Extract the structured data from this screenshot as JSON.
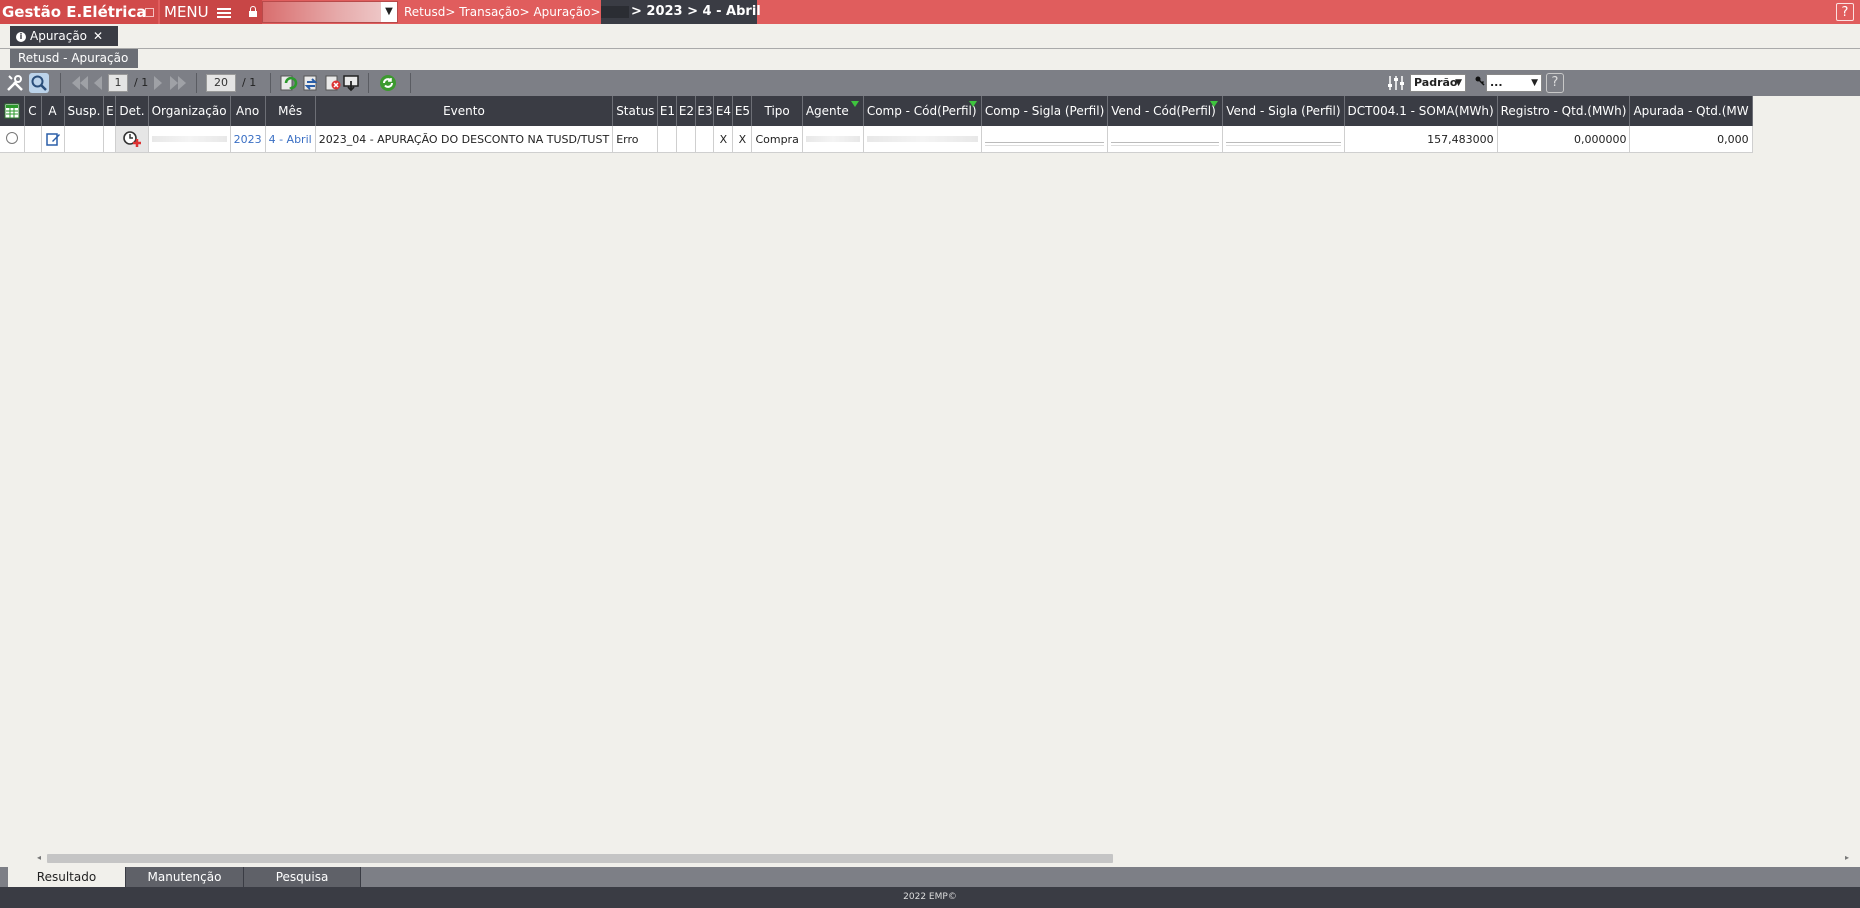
{
  "header": {
    "app_title": "Gestão E.Elétrica",
    "menu_label": "MENU",
    "breadcrumb": "Retusd> Transação> Apuração>",
    "breadcrumb_period": "> 2023 > 4 - Abril",
    "help_label": "?"
  },
  "tabs": {
    "doc_tab_label": "Apuração",
    "doc_tab_close": "✕",
    "sub_tab_label": "Retusd - Apuração"
  },
  "toolbar": {
    "page_current": "1",
    "page_total": "/ 1",
    "page_size": "20",
    "page_size_total": "/ 1",
    "layout_select": "Padrão",
    "filter_select": "..."
  },
  "table": {
    "columns": [
      "C",
      "A",
      "Susp.",
      "E",
      "Det.",
      "Organização",
      "Ano",
      "Mês",
      "Evento",
      "Status",
      "E1",
      "E2",
      "E3",
      "E4",
      "E5",
      "Tipo",
      "Agente",
      "Comp - Cód(Perfil)",
      "Comp - Sigla (Perfil)",
      "Vend - Cód(Perfil)",
      "Vend - Sigla (Perfil)",
      "DCT004.1 - SOMA(MWh)",
      "Registro - Qtd.(MWh)",
      "Apurada - Qtd.(MW"
    ],
    "rows": [
      {
        "ano": "2023",
        "mes": "4 - Abril",
        "evento": "2023_04 - APURAÇÃO DO DESCONTO NA TUSD/TUST",
        "status": "Erro",
        "e1": "",
        "e2": "",
        "e3": "",
        "e4": "X",
        "e5": "X",
        "tipo": "Compra",
        "soma": "157,483000",
        "registro": "0,000000",
        "apurada": "0,000"
      }
    ]
  },
  "bottom_tabs": [
    "Resultado",
    "Manutenção",
    "Pesquisa"
  ],
  "footer": "2022 EMP©",
  "colors": {
    "header_red": "#e05d5d",
    "dark_bar": "#3a3c44",
    "toolbar_gray": "#7d7f86",
    "link_blue": "#3a6fc4",
    "filter_green": "#3ec43e"
  }
}
